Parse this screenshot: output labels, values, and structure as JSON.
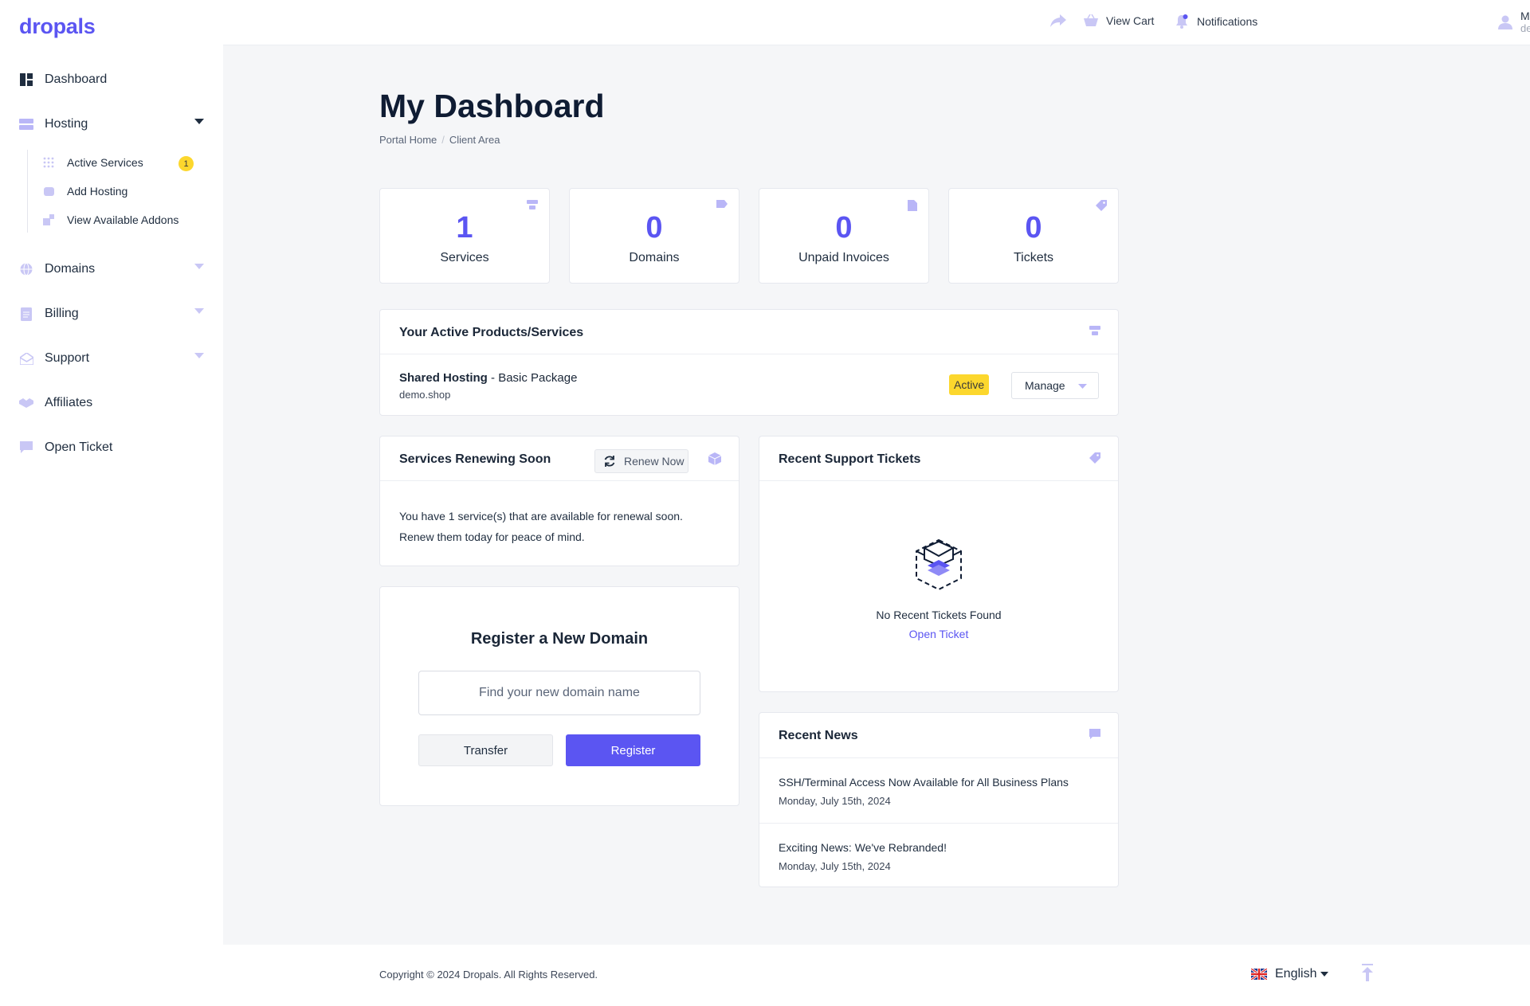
{
  "app": {
    "logo": "dropals"
  },
  "sidebar": {
    "items": [
      {
        "label": "Dashboard"
      },
      {
        "label": "Hosting"
      },
      {
        "label": "Domains"
      },
      {
        "label": "Billing"
      },
      {
        "label": "Support"
      },
      {
        "label": "Affiliates"
      },
      {
        "label": "Open Ticket"
      }
    ],
    "hosting_sub": [
      {
        "label": "Active Services",
        "badge": "1"
      },
      {
        "label": "Add Hosting"
      },
      {
        "label": "View Available Addons"
      }
    ]
  },
  "header": {
    "view_cart": "View Cart",
    "notifications": "Notifications",
    "user_name": "Micky",
    "user_domain": "demo.shop"
  },
  "page": {
    "title": "My Dashboard",
    "breadcrumb": [
      "Portal Home",
      "Client Area"
    ]
  },
  "stats": [
    {
      "value": "1",
      "label": "Services"
    },
    {
      "value": "0",
      "label": "Domains"
    },
    {
      "value": "0",
      "label": "Unpaid Invoices"
    },
    {
      "value": "0",
      "label": "Tickets"
    }
  ],
  "active_products": {
    "title": "Your Active Products/Services",
    "service_name": "Shared Hosting",
    "service_package": " - Basic Package",
    "service_domain": "demo.shop",
    "status": "Active",
    "manage_label": "Manage"
  },
  "renewing": {
    "title": "Services Renewing Soon",
    "renew_label": "Renew Now",
    "line1": "You have 1 service(s) that are available for renewal soon.",
    "line2": "Renew them today for peace of mind."
  },
  "register_domain": {
    "title": "Register a New Domain",
    "placeholder": "Find your new domain name",
    "transfer_label": "Transfer",
    "register_label": "Register"
  },
  "support_tickets": {
    "title": "Recent Support Tickets",
    "empty_text": "No Recent Tickets Found",
    "open_ticket_link": "Open Ticket"
  },
  "news": {
    "title": "Recent News",
    "items": [
      {
        "title": "SSH/Terminal Access Now Available for All Business Plans",
        "date": "Monday, July 15th, 2024"
      },
      {
        "title": "Exciting News: We've Rebranded!",
        "date": "Monday, July 15th, 2024"
      }
    ]
  },
  "footer": {
    "copyright": "Copyright © 2024 Dropals. All Rights Reserved.",
    "language": "English"
  },
  "colors": {
    "accent": "#5b55f2",
    "badge": "#fcd72d",
    "icon_light": "#b9b6f7"
  }
}
